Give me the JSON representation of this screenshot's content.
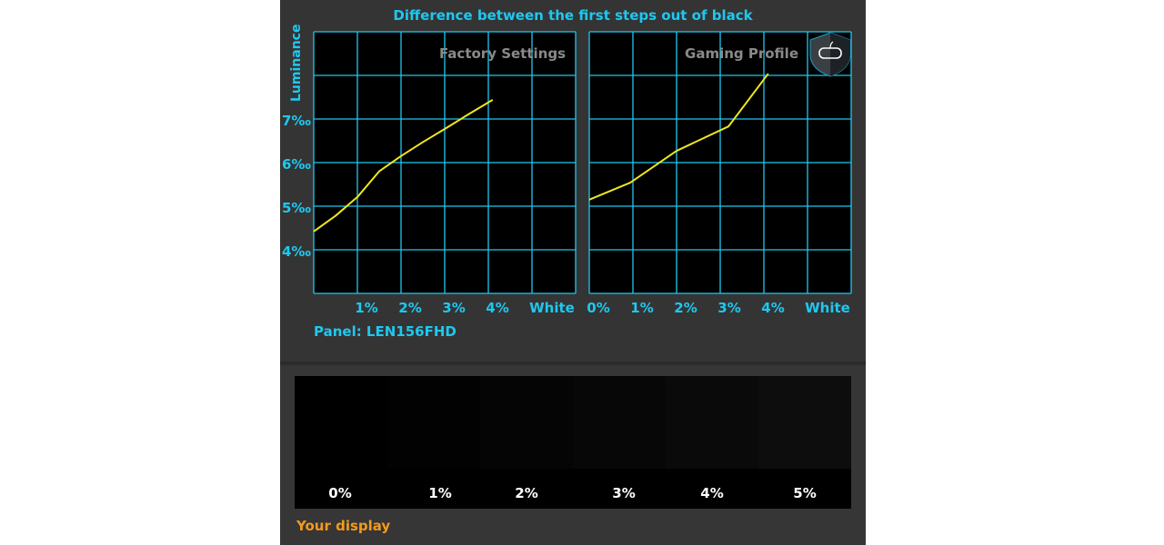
{
  "title": "Difference between the first steps out of black",
  "panel_label": "Panel: LEN156FHD",
  "chart_data": [
    {
      "type": "line",
      "title": "Factory Settings",
      "ylabel": "Luminance",
      "x_tick_labels": [
        "",
        "1%",
        "2%",
        "3%",
        "4%",
        "White"
      ],
      "y_tick_labels": [
        "4‰",
        "5‰",
        "6‰",
        "7‰"
      ],
      "y_tick_values": [
        4,
        5,
        6,
        7
      ],
      "xlim": [
        0,
        6
      ],
      "ylim": [
        3,
        9
      ],
      "grid": true,
      "series": [
        {
          "color": "#f0e61e",
          "x": [
            0,
            0.5,
            1,
            1.5,
            2,
            2.5,
            3,
            3.5,
            4.1
          ],
          "y": [
            4.42,
            4.78,
            5.21,
            5.8,
            6.15,
            6.47,
            6.77,
            7.08,
            7.44
          ]
        }
      ]
    },
    {
      "type": "line",
      "title": "Gaming Profile",
      "x_tick_labels": [
        "0%",
        "1%",
        "2%",
        "3%",
        "4%",
        "White"
      ],
      "xlim": [
        0,
        6
      ],
      "ylim": [
        3,
        9
      ],
      "grid": true,
      "icon": "shield-gamepad-icon",
      "series": [
        {
          "color": "#f0e61e",
          "x": [
            0,
            0.94,
            2,
            3.19,
            4.1
          ],
          "y": [
            5.15,
            5.54,
            6.27,
            6.83,
            8.04
          ]
        }
      ]
    }
  ],
  "swatches": [
    {
      "label": "0%",
      "color": "#000000"
    },
    {
      "label": "1%",
      "color": "#020202"
    },
    {
      "label": "2%",
      "color": "#050505"
    },
    {
      "label": "3%",
      "color": "#070707"
    },
    {
      "label": "4%",
      "color": "#0a0a0a"
    },
    {
      "label": "5%",
      "color": "#0d0d0d"
    }
  ],
  "your_display": "Your display",
  "colors": {
    "accent": "#1ec8f0",
    "curve": "#f0e61e",
    "your_display": "#f39a1e",
    "background": "#333333"
  }
}
